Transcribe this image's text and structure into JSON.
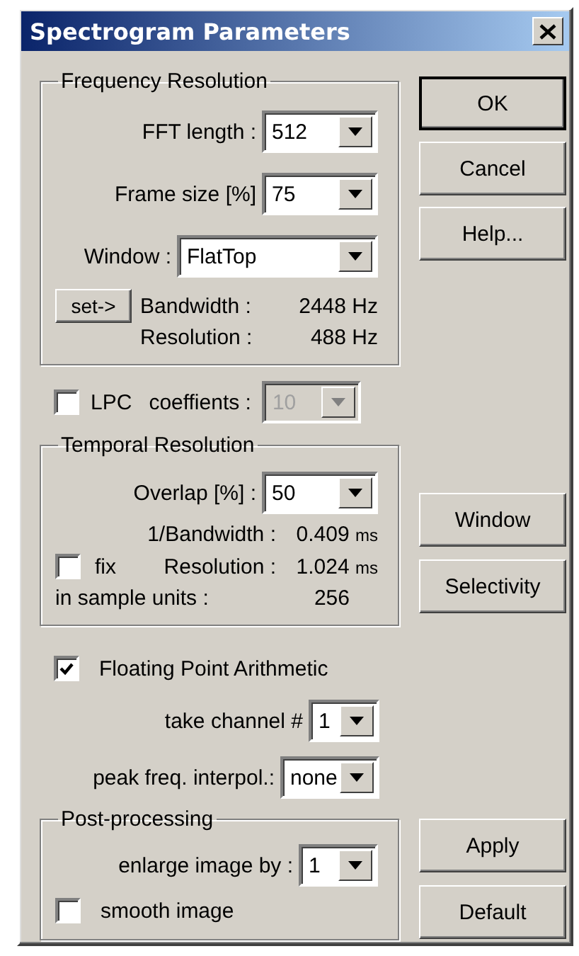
{
  "window": {
    "title": "Spectrogram Parameters"
  },
  "frequency_resolution": {
    "title": "Frequency Resolution",
    "fields": [
      {
        "label": "FFT length :",
        "value": "512"
      },
      {
        "label": "Frame size [%]",
        "value": "75"
      },
      {
        "label": "Window :",
        "value": "FlatTop"
      }
    ],
    "set_button": "set->",
    "readouts": [
      {
        "label": "Bandwidth :",
        "value": "2448 Hz"
      },
      {
        "label": "Resolution :",
        "value": "488 Hz"
      }
    ]
  },
  "buttons_top": [
    "OK",
    "Cancel",
    "Help..."
  ],
  "lpc": {
    "label": "LPC",
    "checked": false,
    "coefficients": {
      "label": "coeffients :",
      "value": "10",
      "disabled": true
    }
  },
  "temporal_resolution": {
    "title": "Temporal Resolution",
    "overlap": {
      "label": "Overlap [%] :",
      "value": "50"
    },
    "inverse_bandwidth": {
      "label": "1/Bandwidth :",
      "value": "0.409",
      "unit": "ms"
    },
    "fix": {
      "label": "fix",
      "checked": false
    },
    "resolution": {
      "label": "Resolution :",
      "value": "1.024",
      "unit": "ms"
    },
    "sample_units": {
      "label": "in sample units :",
      "value": "256"
    }
  },
  "buttons_middle": [
    "Window",
    "Selectivity"
  ],
  "floating_point": {
    "label": "Floating Point Arithmetic",
    "checked": true
  },
  "channel": {
    "label": "take channel #",
    "value": "1"
  },
  "peak_interpolation": {
    "label": "peak freq. interpol.:",
    "value": "none"
  },
  "post_processing": {
    "title": "Post-processing",
    "enlarge": {
      "label": "enlarge image by :",
      "value": "1"
    },
    "smooth": {
      "label": "smooth image",
      "checked": false
    }
  },
  "buttons_bottom": [
    "Apply",
    "Default"
  ]
}
